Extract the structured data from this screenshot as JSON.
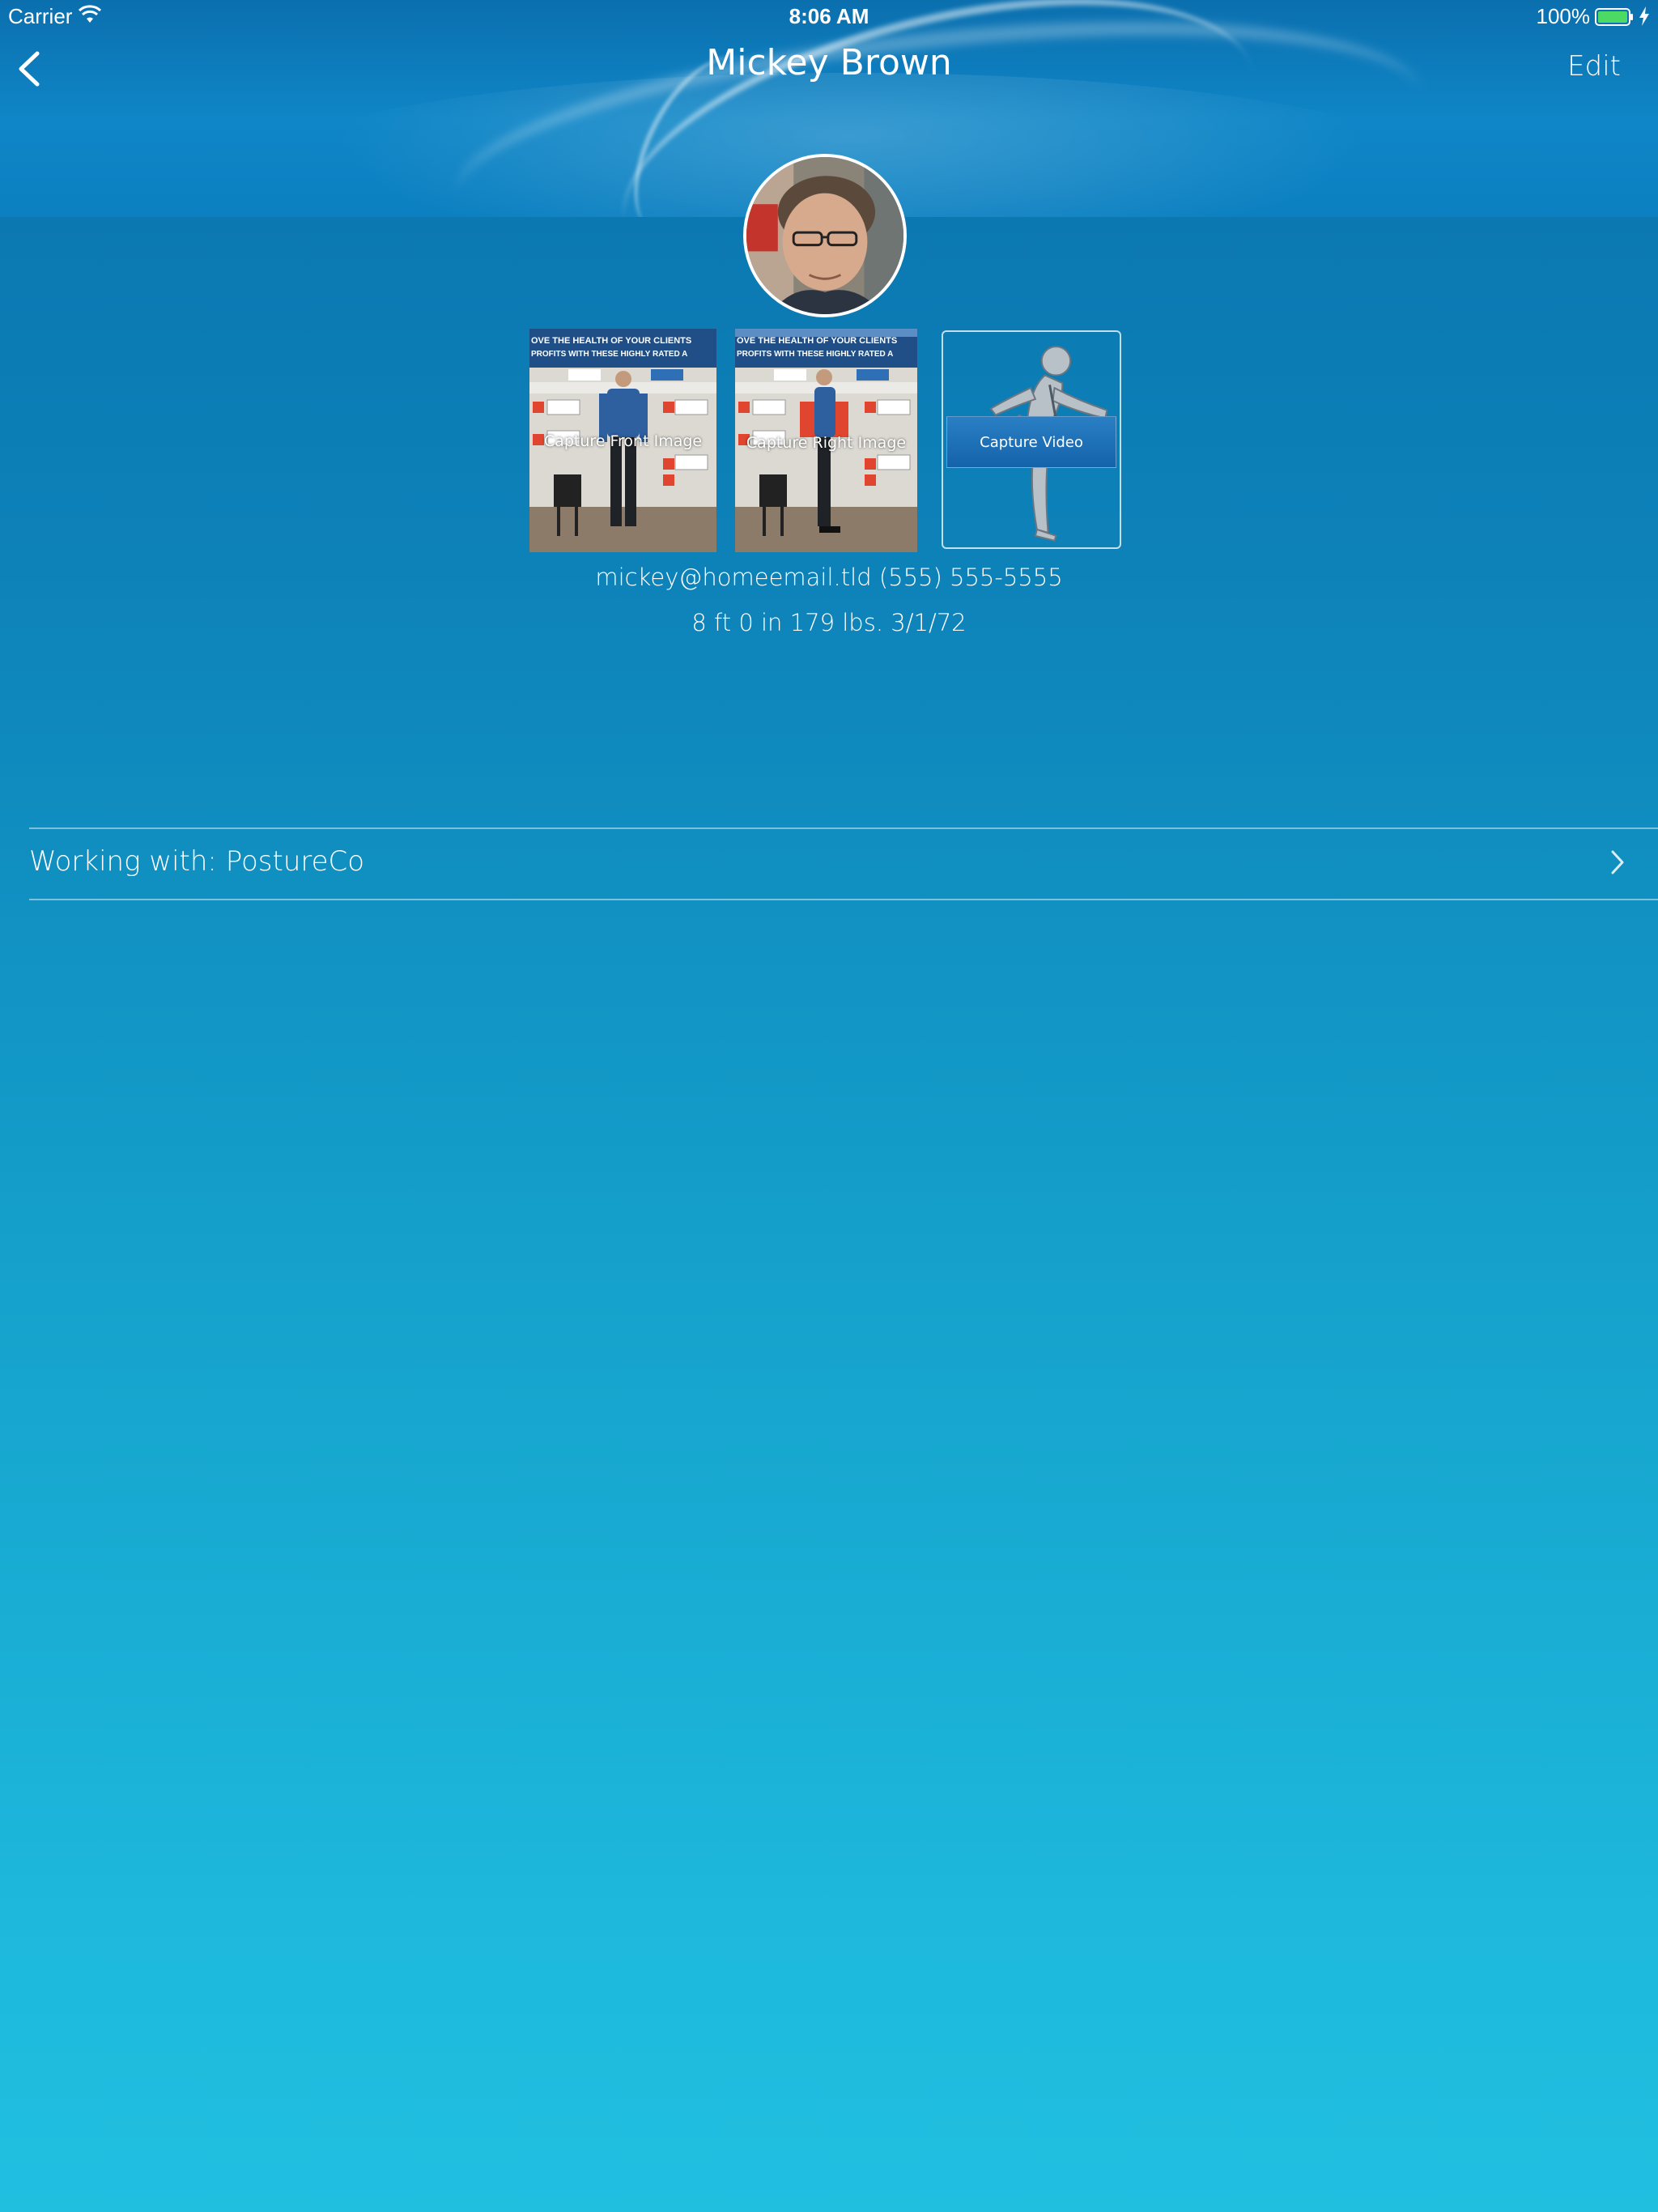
{
  "status_bar": {
    "carrier": "Carrier",
    "time": "8:06 AM",
    "battery": "100%",
    "icons": [
      "wifi-icon",
      "battery-icon",
      "charging-bolt-icon"
    ]
  },
  "nav": {
    "title": "Mickey Brown",
    "edit_label": "Edit",
    "back_icon": "chevron-left-icon"
  },
  "profile": {
    "avatar_icon": "profile-photo",
    "email": "mickey@homeemail.tld",
    "phone": "(555) 555-5555",
    "height": "8 ft 0 in",
    "weight": "179 lbs.",
    "dob": "3/1/72"
  },
  "media": {
    "front_label": "Capture Front Image",
    "right_label": "Capture Right Image",
    "video_label": "Capture Video",
    "banner_text_1": "OVE THE HEALTH OF YOUR CLIENTS",
    "banner_text_2": "PROFITS WITH THESE HIGHLY RATED A"
  },
  "working_with": {
    "label": "Working with: PostureCo"
  },
  "colors": {
    "bg_top": "#0a72ad",
    "bg_bottom": "#20bfe0",
    "video_button": "#1c70b8",
    "accent_red": "#e0452f"
  }
}
